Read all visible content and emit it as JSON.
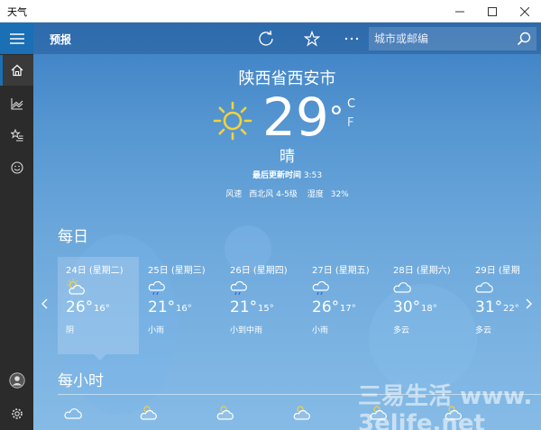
{
  "window": {
    "title": "天气"
  },
  "topbar": {
    "forecast_label": "预报",
    "search_placeholder": "城市或邮编"
  },
  "current": {
    "city": "陕西省西安市",
    "temperature": "29",
    "degree": "°",
    "unit_c": "C",
    "unit_f": "F",
    "condition": "晴",
    "updated_label": "最后更新时间",
    "updated_time": "3:53",
    "wind_label": "风速",
    "wind_value": "西北风 4-5级",
    "humidity_label": "湿度",
    "humidity_value": "32%"
  },
  "daily": {
    "heading": "每日",
    "days": [
      {
        "name": "24日 (星期二)",
        "icon": "partly-sunny-icon",
        "hi": "26°",
        "lo": "16°",
        "cond": "阴"
      },
      {
        "name": "25日 (星期三)",
        "icon": "rain-icon",
        "hi": "21°",
        "lo": "16°",
        "cond": "小雨"
      },
      {
        "name": "26日 (星期四)",
        "icon": "rain-icon",
        "hi": "21°",
        "lo": "15°",
        "cond": "小到中雨"
      },
      {
        "name": "27日 (星期五)",
        "icon": "rain-icon",
        "hi": "26°",
        "lo": "17°",
        "cond": "小雨"
      },
      {
        "name": "28日 (星期六)",
        "icon": "cloudy-icon",
        "hi": "30°",
        "lo": "18°",
        "cond": "多云"
      },
      {
        "name": "29日 (星期",
        "icon": "cloudy-icon",
        "hi": "31°",
        "lo": "22°",
        "cond": "多云"
      }
    ]
  },
  "hourly": {
    "heading": "每小时"
  },
  "watermark": "三易生活 www.3elife.net"
}
